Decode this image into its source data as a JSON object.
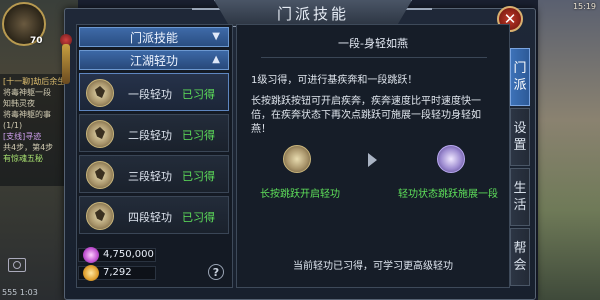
{
  "scene": {
    "level": "70",
    "time": "15:19",
    "chat": [
      {
        "text": "[十一聊]劫后余生",
        "cls": "c1"
      },
      {
        "text": "将毒神躯一段",
        "cls": ""
      },
      {
        "text": "知韩灵夜",
        "cls": ""
      },
      {
        "text": "将毒神躯的事",
        "cls": ""
      },
      {
        "text": "(1/1)",
        "cls": ""
      },
      {
        "text": "[支线]寻迹",
        "cls": "c3"
      },
      {
        "text": "共4步，第4步",
        "cls": ""
      },
      {
        "text": "有惊魂五秘",
        "cls": "c2"
      }
    ],
    "bottom_text": "555  1:03"
  },
  "window": {
    "title": "门派技能",
    "close_label": "✕"
  },
  "left_panel": {
    "tabs": [
      {
        "label": "门派技能",
        "arrow": "▼"
      },
      {
        "label": "江湖轻功",
        "arrow": "▲"
      }
    ],
    "skills": [
      {
        "name": "一段轻功",
        "status": "已习得",
        "selected": true
      },
      {
        "name": "二段轻功",
        "status": "已习得",
        "selected": false
      },
      {
        "name": "三段轻功",
        "status": "已习得",
        "selected": false
      },
      {
        "name": "四段轻功",
        "status": "已习得",
        "selected": false
      }
    ],
    "currency": [
      {
        "icon": "gem-icon",
        "value": "4,750,000"
      },
      {
        "icon": "gold-icon",
        "value": "7,292"
      }
    ],
    "help_label": "?"
  },
  "detail": {
    "title": "一段-身轻如燕",
    "subtitle": "1级习得，可进行基疾奔和一段跳跃！",
    "description": "长按跳跃按钮可开启疾奔，疾奔速度比平时速度快一倍，在疾奔状态下再次点跳跃可施展一段轻功身轻如燕！",
    "demo_left_caption": "长按跳跃开启轻功",
    "demo_right_caption": "轻功状态跳跃施展一段",
    "footer": "当前轻功已习得，可学习更高级轻功"
  },
  "side_tabs": [
    {
      "chars": [
        "门",
        "派"
      ],
      "active": true
    },
    {
      "chars": [
        "设",
        "置"
      ],
      "active": false
    },
    {
      "chars": [
        "生",
        "活"
      ],
      "active": false
    },
    {
      "chars": [
        "帮",
        "会"
      ],
      "active": false
    }
  ],
  "colors": {
    "accent": "#3e6aa8",
    "learned": "#5ee05a",
    "close": "#c23a2a"
  }
}
